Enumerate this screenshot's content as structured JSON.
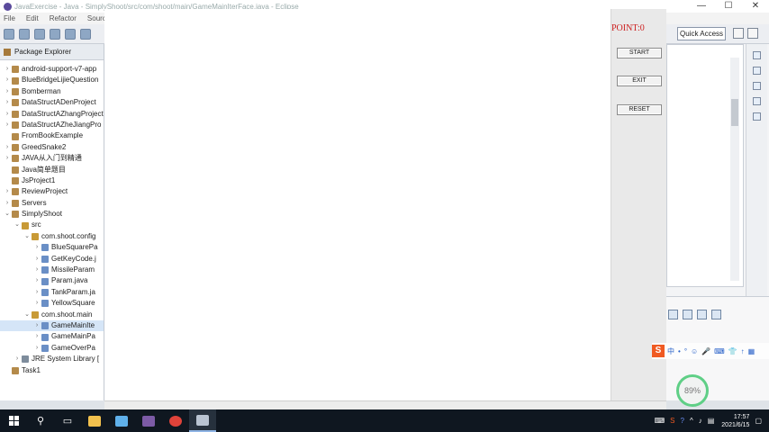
{
  "window": {
    "title": "JavaExercise - Java - SimplyShoot/src/com/shoot/main/GameMainIterFace.java - Eclipse",
    "controls": {
      "minimize": "—",
      "maximize": "☐",
      "close": "✕"
    }
  },
  "menubar": {
    "items": [
      "File",
      "Edit",
      "Refactor",
      "Source"
    ]
  },
  "toolbar": {
    "quick_access": "Quick Access"
  },
  "explorer": {
    "title": "Package Explorer",
    "items": [
      {
        "label": "android-support-v7-app",
        "indent": 0,
        "expander": "›",
        "type": "project"
      },
      {
        "label": "BlueBridgeLijieQuestion",
        "indent": 0,
        "expander": "›",
        "type": "project"
      },
      {
        "label": "Bomberman",
        "indent": 0,
        "expander": "›",
        "type": "project"
      },
      {
        "label": "DataStructADenProject",
        "indent": 0,
        "expander": "›",
        "type": "project"
      },
      {
        "label": "DataStructAZhangProject",
        "indent": 0,
        "expander": "›",
        "type": "project"
      },
      {
        "label": "DataStructAZheJiangPro",
        "indent": 0,
        "expander": "›",
        "type": "project"
      },
      {
        "label": "FromBookExample",
        "indent": 0,
        "expander": "",
        "type": "project"
      },
      {
        "label": "GreedSnake2",
        "indent": 0,
        "expander": "›",
        "type": "project"
      },
      {
        "label": "JAVA从入门到精通",
        "indent": 0,
        "expander": "›",
        "type": "project"
      },
      {
        "label": "Java简单题目",
        "indent": 0,
        "expander": "",
        "type": "project"
      },
      {
        "label": "JsProject1",
        "indent": 0,
        "expander": "",
        "type": "project"
      },
      {
        "label": "ReviewProject",
        "indent": 0,
        "expander": "›",
        "type": "project"
      },
      {
        "label": "Servers",
        "indent": 0,
        "expander": "›",
        "type": "project"
      },
      {
        "label": "SimplyShoot",
        "indent": 0,
        "expander": "⌄",
        "type": "project"
      },
      {
        "label": "src",
        "indent": 1,
        "expander": "⌄",
        "type": "pkg"
      },
      {
        "label": "com.shoot.config",
        "indent": 2,
        "expander": "⌄",
        "type": "pkg"
      },
      {
        "label": "BlueSquarePa",
        "indent": 3,
        "expander": "›",
        "type": "java"
      },
      {
        "label": "GetKeyCode.j",
        "indent": 3,
        "expander": "›",
        "type": "java"
      },
      {
        "label": "MissileParam",
        "indent": 3,
        "expander": "›",
        "type": "java"
      },
      {
        "label": "Param.java",
        "indent": 3,
        "expander": "›",
        "type": "java"
      },
      {
        "label": "TankParam.ja",
        "indent": 3,
        "expander": "›",
        "type": "java"
      },
      {
        "label": "YellowSquare",
        "indent": 3,
        "expander": "›",
        "type": "java"
      },
      {
        "label": "com.shoot.main",
        "indent": 2,
        "expander": "⌄",
        "type": "pkg"
      },
      {
        "label": "GameMainIte",
        "indent": 3,
        "expander": "›",
        "type": "java",
        "selected": true
      },
      {
        "label": "GameMainPa",
        "indent": 3,
        "expander": "›",
        "type": "java"
      },
      {
        "label": "GameOverPa",
        "indent": 3,
        "expander": "›",
        "type": "java"
      },
      {
        "label": "JRE System Library [",
        "indent": 1,
        "expander": "›",
        "type": "lib"
      },
      {
        "label": "Task1",
        "indent": 0,
        "expander": "",
        "type": "project"
      }
    ]
  },
  "game": {
    "points_label": "POINT:0",
    "start_label": "START",
    "exit_label": "EXIT",
    "reset_label": "RESET"
  },
  "ime": {
    "logo": "S",
    "items": [
      "中",
      "•",
      "°",
      "☺",
      "🎤",
      "⌨",
      "👕",
      "↑",
      "▦"
    ]
  },
  "gauge": {
    "value": "89%"
  },
  "taskbar": {
    "search_icon": "⚲",
    "apps": [
      {
        "name": "file-explorer",
        "color": "#f2c14e"
      },
      {
        "name": "notepad",
        "color": "#5fb0ea"
      },
      {
        "name": "game-app",
        "color": "#7c5ba6"
      },
      {
        "name": "chrome",
        "color": "#e0433a"
      },
      {
        "name": "java-app",
        "color": "#b9c4d2",
        "active": true
      }
    ],
    "clock_time": "17:57",
    "clock_date": "2021/6/15"
  }
}
